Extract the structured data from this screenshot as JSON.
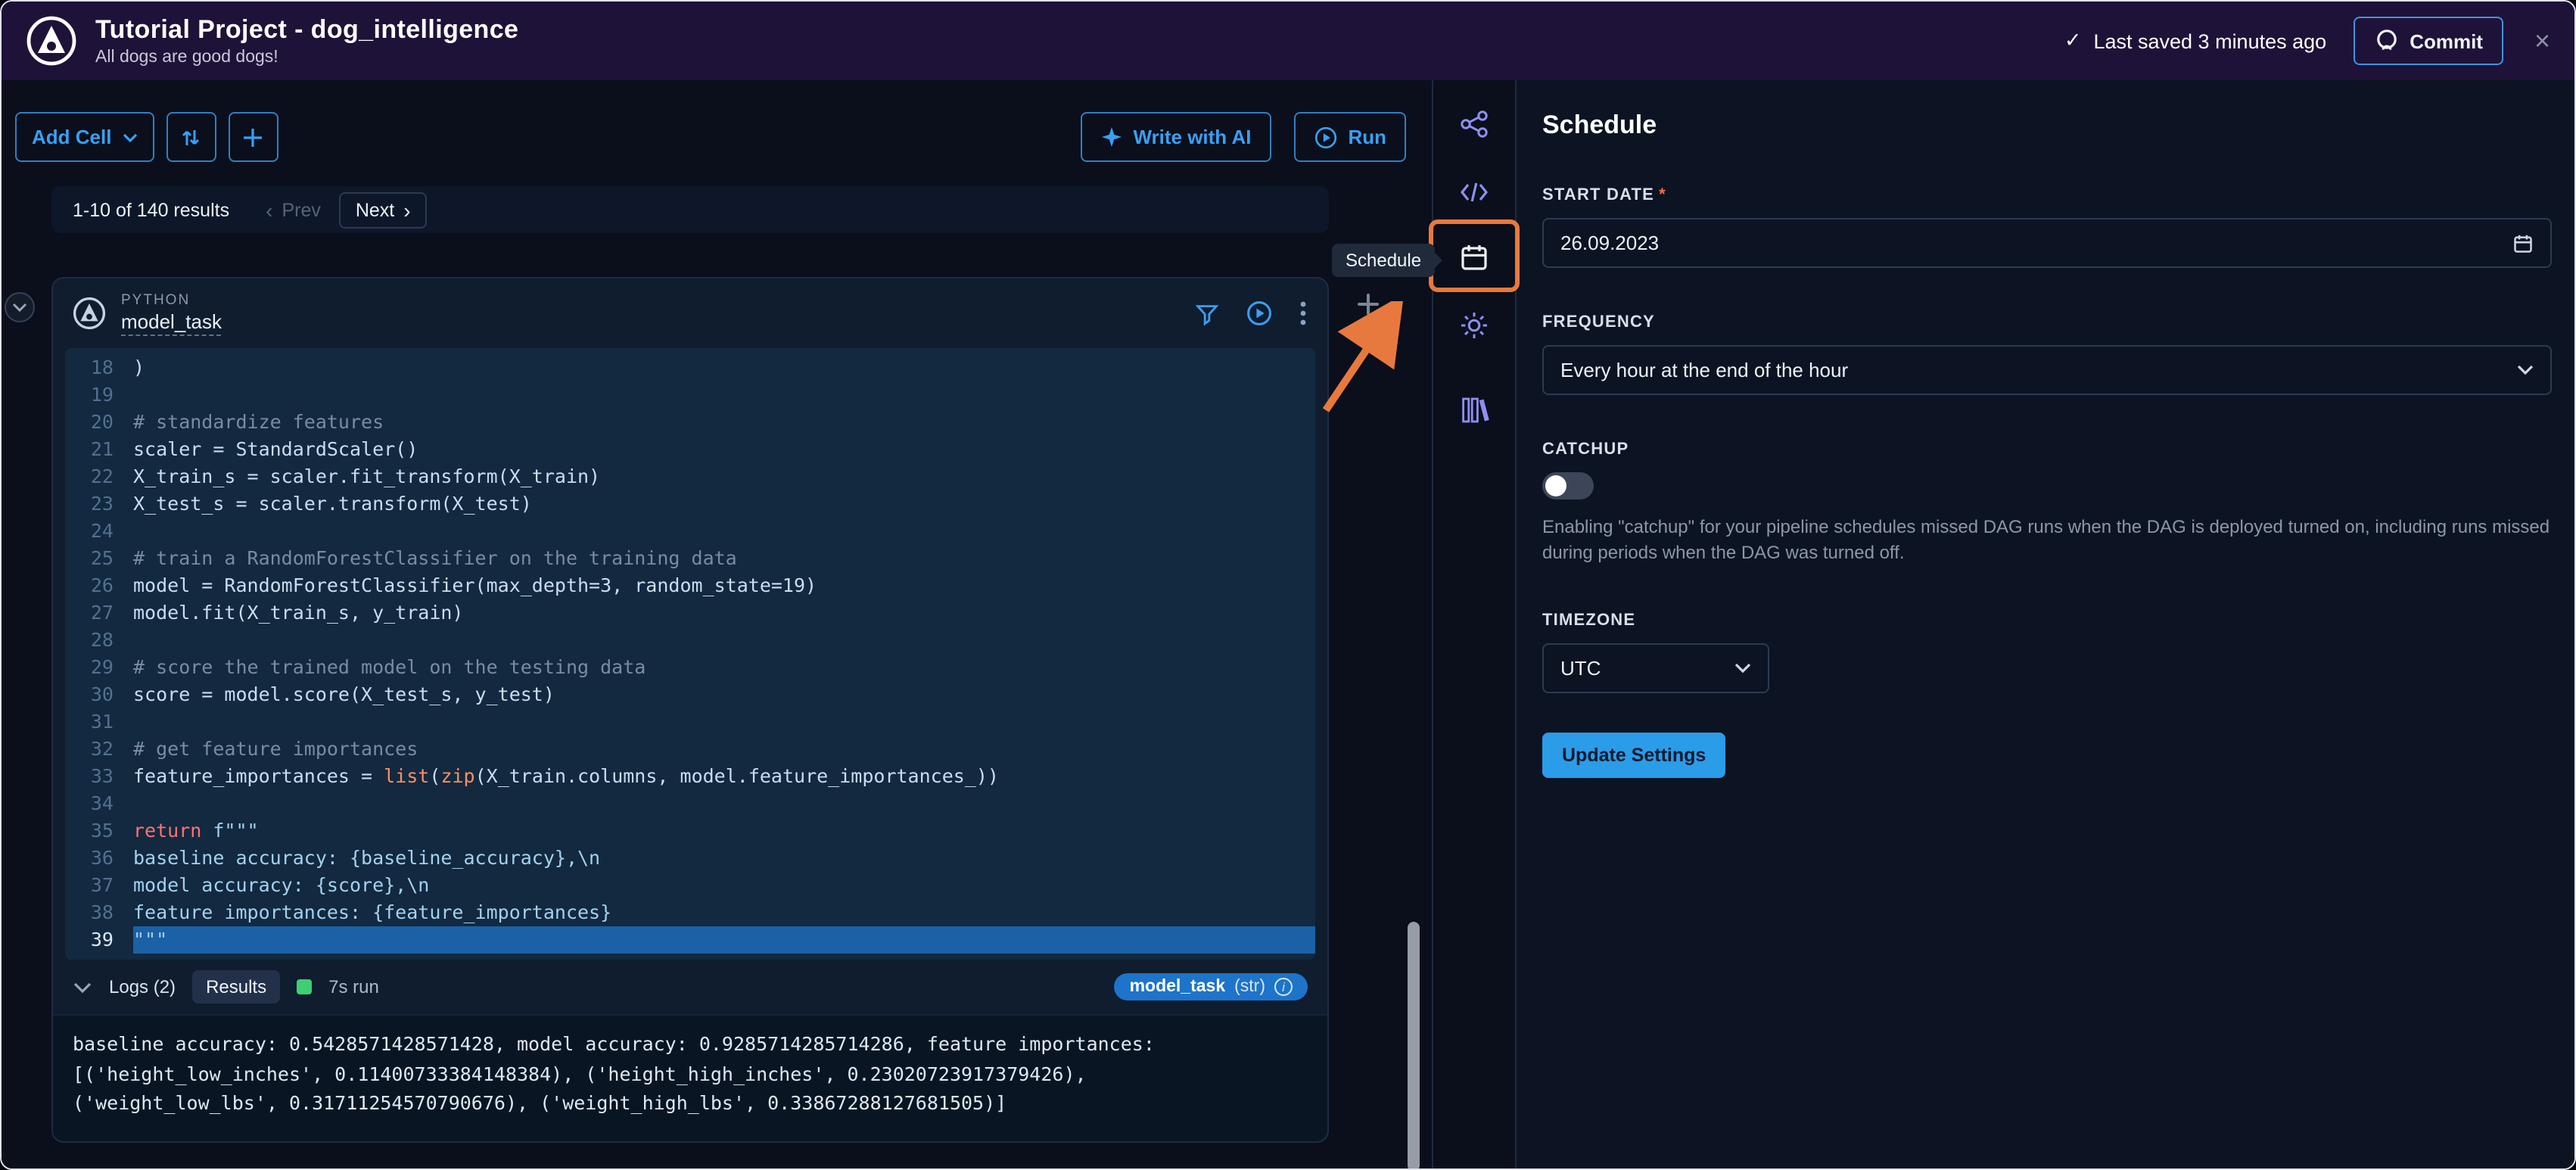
{
  "colors": {
    "accent": "#39a0f4",
    "annotation": "#e8793e",
    "success": "#3ecf71",
    "header_bg": "#1f1238"
  },
  "glyphs": {
    "check": "✓",
    "close": "×",
    "chevron_left": "‹",
    "chevron_right": "›",
    "info": "i"
  },
  "header": {
    "title": "Tutorial Project - dog_intelligence",
    "subtitle": "All dogs are good dogs!",
    "saved_status": "Last saved 3 minutes ago",
    "commit_label": "Commit"
  },
  "toolbar": {
    "add_cell_label": "Add Cell",
    "write_with_ai_label": "Write with AI",
    "run_label": "Run"
  },
  "pagination": {
    "results_text": "1-10 of 140 results",
    "prev_label": "Prev",
    "next_label": "Next"
  },
  "cell": {
    "language": "PYTHON",
    "name": "model_task",
    "logs_label": "Logs (2)",
    "results_label": "Results",
    "runtime_label": "7s run",
    "output_badge_name": "model_task",
    "output_badge_type": "(str)",
    "code_lines": [
      {
        "num": 18,
        "tokens": [
          {
            "c": "pln",
            "t": ")"
          }
        ]
      },
      {
        "num": 19,
        "tokens": []
      },
      {
        "num": 20,
        "tokens": [
          {
            "c": "com",
            "t": "# standardize features"
          }
        ]
      },
      {
        "num": 21,
        "tokens": [
          {
            "c": "pln",
            "t": "scaler = StandardScaler()"
          }
        ]
      },
      {
        "num": 22,
        "tokens": [
          {
            "c": "pln",
            "t": "X_train_s = scaler.fit_transform(X_train)"
          }
        ]
      },
      {
        "num": 23,
        "tokens": [
          {
            "c": "pln",
            "t": "X_test_s = scaler.transform(X_test)"
          }
        ]
      },
      {
        "num": 24,
        "tokens": []
      },
      {
        "num": 25,
        "tokens": [
          {
            "c": "com",
            "t": "# train a RandomForestClassifier on the training data"
          }
        ]
      },
      {
        "num": 26,
        "tokens": [
          {
            "c": "pln",
            "t": "model = RandomForestClassifier(max_depth=3, random_state=19)"
          }
        ]
      },
      {
        "num": 27,
        "tokens": [
          {
            "c": "pln",
            "t": "model.fit(X_train_s, y_train)"
          }
        ]
      },
      {
        "num": 28,
        "tokens": []
      },
      {
        "num": 29,
        "tokens": [
          {
            "c": "com",
            "t": "# score the trained model on the testing data"
          }
        ]
      },
      {
        "num": 30,
        "tokens": [
          {
            "c": "pln",
            "t": "score = model.score(X_test_s, y_test)"
          }
        ]
      },
      {
        "num": 31,
        "tokens": []
      },
      {
        "num": 32,
        "tokens": [
          {
            "c": "com",
            "t": "# get feature importances"
          }
        ]
      },
      {
        "num": 33,
        "tokens": [
          {
            "c": "pln",
            "t": "feature_importances = "
          },
          {
            "c": "fn",
            "t": "list"
          },
          {
            "c": "pln",
            "t": "("
          },
          {
            "c": "fn",
            "t": "zip"
          },
          {
            "c": "pln",
            "t": "(X_train.columns, model.feature_importances_))"
          }
        ]
      },
      {
        "num": 34,
        "tokens": []
      },
      {
        "num": 35,
        "tokens": [
          {
            "c": "kw",
            "t": "return"
          },
          {
            "c": "pln",
            "t": " "
          },
          {
            "c": "str",
            "t": "f\"\"\""
          }
        ]
      },
      {
        "num": 36,
        "tokens": [
          {
            "c": "str",
            "t": "baseline accuracy: {baseline_accuracy},\\n"
          }
        ]
      },
      {
        "num": 37,
        "tokens": [
          {
            "c": "str",
            "t": "model accuracy: {score},\\n"
          }
        ]
      },
      {
        "num": 38,
        "tokens": [
          {
            "c": "str",
            "t": "feature importances: {feature_importances}"
          }
        ]
      },
      {
        "num": 39,
        "hl": true,
        "tokens": [
          {
            "c": "str",
            "t": "\"\"\""
          }
        ]
      }
    ],
    "output_lines": [
      "baseline accuracy: 0.5428571428571428, model accuracy: 0.9285714285714286, feature importances:",
      "[('height_low_inches', 0.11400733384148384), ('height_high_inches', 0.23020723917379426),",
      "('weight_low_lbs', 0.31711254570790676), ('weight_high_lbs', 0.33867288127681505)]"
    ]
  },
  "tooltip_label": "Schedule",
  "panel": {
    "title": "Schedule",
    "start_date_label": "START DATE",
    "required_mark": "*",
    "start_date_value": "26.09.2023",
    "frequency_label": "FREQUENCY",
    "frequency_value": "Every hour at the end of the hour",
    "catchup_label": "CATCHUP",
    "catchup_help": "Enabling \"catchup\" for your pipeline schedules missed DAG runs when the DAG is deployed turned on, including runs missed during periods when the DAG was turned off.",
    "timezone_label": "TIMEZONE",
    "timezone_value": "UTC",
    "update_button_label": "Update Settings"
  }
}
